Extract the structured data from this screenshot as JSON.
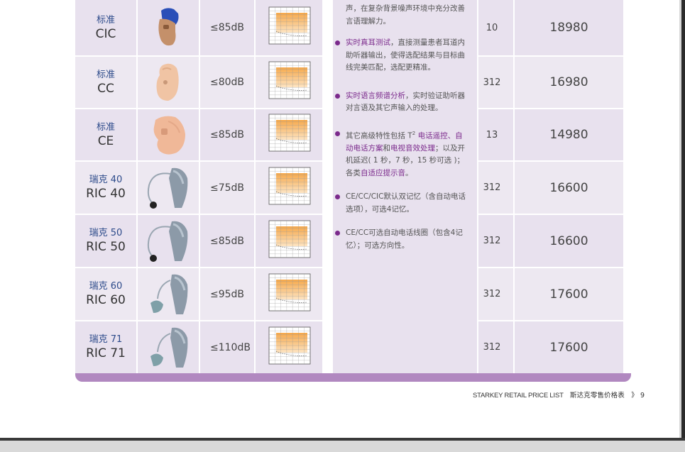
{
  "products": [
    {
      "name_cn": "标准",
      "name_en": "CIC",
      "max_loss": "≤85dB",
      "battery": "10",
      "price": "18980",
      "icon": "cic-hearing-aid-icon"
    },
    {
      "name_cn": "标准",
      "name_en": "CC",
      "max_loss": "≤80dB",
      "battery": "312",
      "price": "16980",
      "icon": "cc-hearing-aid-icon"
    },
    {
      "name_cn": "标准",
      "name_en": "CE",
      "max_loss": "≤85dB",
      "battery": "13",
      "price": "14980",
      "icon": "ce-hearing-aid-icon"
    },
    {
      "name_cn": "瑞克 40",
      "name_en": "RIC 40",
      "max_loss": "≤75dB",
      "battery": "312",
      "price": "16600",
      "icon": "ric-hearing-aid-icon"
    },
    {
      "name_cn": "瑞克 50",
      "name_en": "RIC 50",
      "max_loss": "≤85dB",
      "battery": "312",
      "price": "16600",
      "icon": "ric-hearing-aid-icon"
    },
    {
      "name_cn": "瑞克 60",
      "name_en": "RIC 60",
      "max_loss": "≤95dB",
      "battery": "312",
      "price": "17600",
      "icon": "ric-hearing-aid-icon"
    },
    {
      "name_cn": "瑞克 71",
      "name_en": "RIC 71",
      "max_loss": "≤110dB",
      "battery": "312",
      "price": "17600",
      "icon": "ric-hearing-aid-icon"
    }
  ],
  "features": {
    "f0_text": "声，在复杂背景噪声环境中充分改善言语理解力。",
    "f1_hl": "实时真耳测试",
    "f1_text": "，直接测量患者耳道内助听器输出，使得选配结果与目标曲线完美匹配，选配更精准。",
    "f2_hl": "实时语言频谱分析",
    "f2_text": "，实时验证助听器对言语及其它声输入的处理。",
    "f3_a": "其它高级特性包括 T",
    "f3_sup": "2",
    "f3_hl1": " 电话遥控、自动电话方案",
    "f3_b": "和",
    "f3_hl2": "电视音效处理",
    "f3_c": "；以及开机延迟( 1 秒，7 秒，15 秒可选 )；各类",
    "f3_hl3": "自适应提示音",
    "f3_d": "。",
    "f4_text": "CE/CC/CIC默认双记忆（含自动电话选项），可选4记忆。",
    "f5_text": "CE/CC可选自动电话线圈（包含4记忆）；可选方向性。"
  },
  "footer": {
    "en": "STARKEY RETAIL PRICE LIST",
    "cn": "斯达克零售价格表",
    "sep": "》",
    "page": "9"
  },
  "colors": {
    "cell_bg": "#e8e1ee",
    "accent_purple": "#7b2a8c",
    "band": "#b188c0",
    "chart_fill": "#f6a84a"
  }
}
